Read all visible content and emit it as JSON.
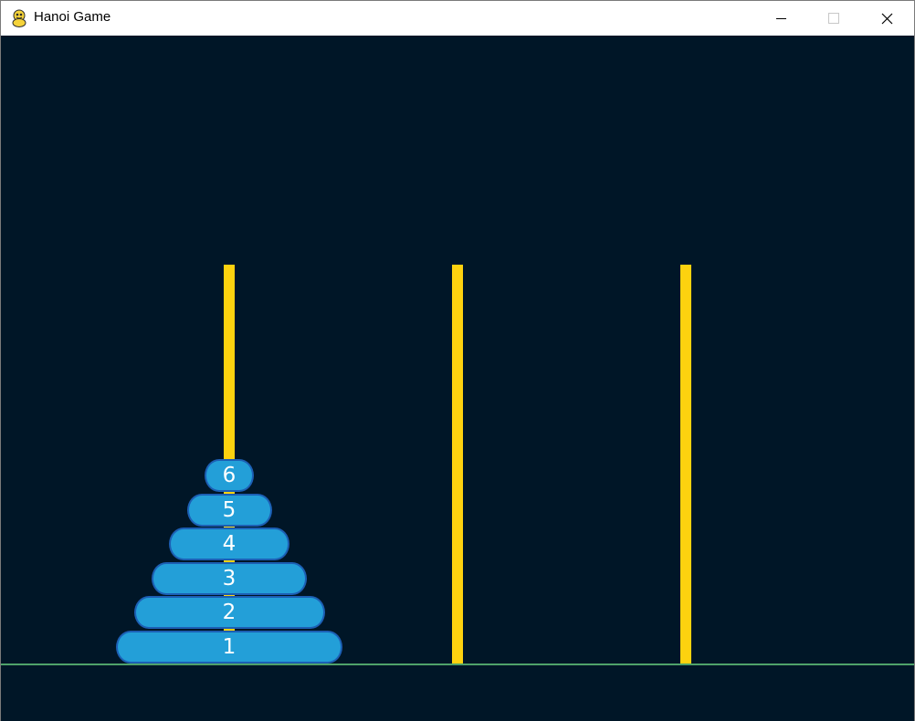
{
  "window": {
    "title": "Hanoi Game"
  },
  "game": {
    "background_color": "#001627",
    "peg_color": "#fdd20f",
    "disk_color": "#239fd8",
    "disk_border_color": "#1c5fb4",
    "ground_color": "#4fa26a",
    "pegs": [
      {
        "name": "peg-1",
        "disks": [
          "1",
          "2",
          "3",
          "4",
          "5",
          "6"
        ]
      },
      {
        "name": "peg-2",
        "disks": []
      },
      {
        "name": "peg-3",
        "disks": []
      }
    ]
  }
}
